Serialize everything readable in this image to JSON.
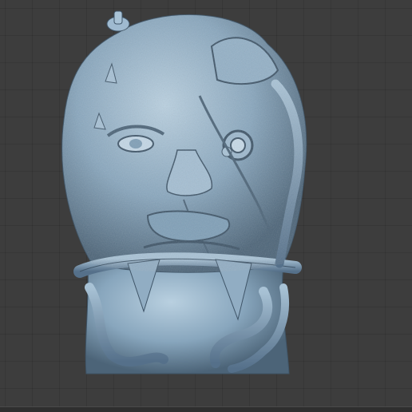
{
  "viewport": {
    "background": "#3d3d3d",
    "grid_color": "#353535"
  },
  "model": {
    "icon": "sculpted-head-model",
    "base_color": "#7f9fb7",
    "light_color": "#b9d0e0",
    "shadow_color": "#3f5568"
  }
}
